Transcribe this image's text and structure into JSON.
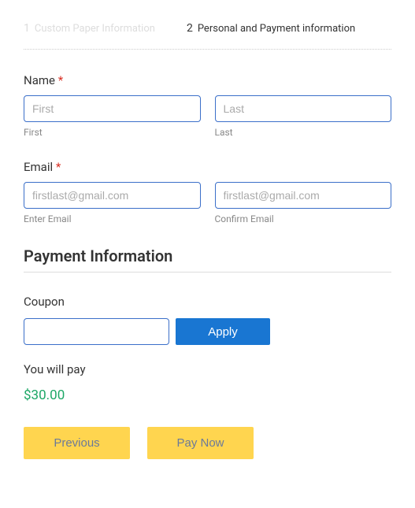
{
  "steps": {
    "step1": {
      "num": "1",
      "label": "Custom Paper Information"
    },
    "step2": {
      "num": "2",
      "label": "Personal and Payment information"
    }
  },
  "name": {
    "label": "Name",
    "required": "*",
    "first": {
      "placeholder": "First",
      "sublabel": "First"
    },
    "last": {
      "placeholder": "Last",
      "sublabel": "Last"
    }
  },
  "email": {
    "label": "Email",
    "required": "*",
    "enter": {
      "placeholder": "firstlast@gmail.com",
      "sublabel": "Enter Email"
    },
    "confirm": {
      "placeholder": "firstlast@gmail.com",
      "sublabel": "Confirm Email"
    }
  },
  "payment": {
    "header": "Payment Information",
    "coupon_label": "Coupon",
    "apply_label": "Apply",
    "pay_label": "You will pay",
    "amount": "$30.00"
  },
  "nav": {
    "previous": "Previous",
    "paynow": "Pay Now"
  }
}
